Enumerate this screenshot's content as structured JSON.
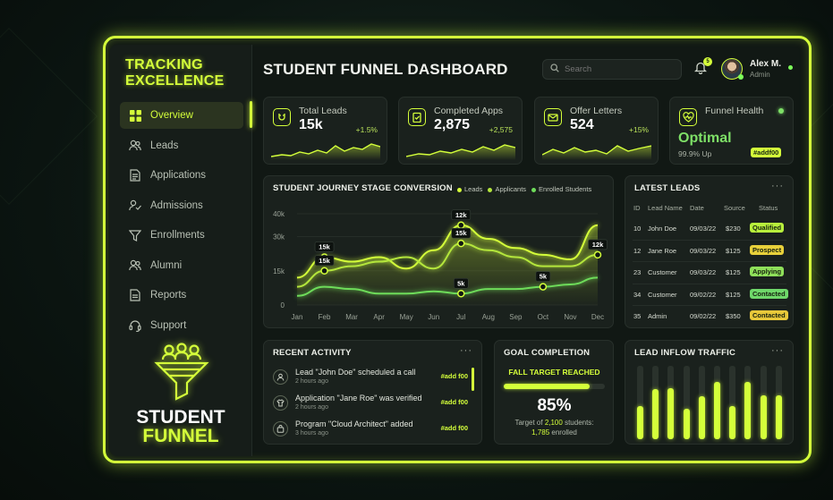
{
  "sidebar": {
    "brand_line1": "TRACKING",
    "brand_line2": "EXCELLENCE",
    "items": [
      {
        "label": "Overview",
        "icon": "grid-icon",
        "active": true
      },
      {
        "label": "Leads",
        "icon": "users-icon"
      },
      {
        "label": "Applications",
        "icon": "document-icon"
      },
      {
        "label": "Admissions",
        "icon": "user-check-icon"
      },
      {
        "label": "Enrollments",
        "icon": "funnel-icon"
      },
      {
        "label": "Alumni",
        "icon": "users-icon"
      },
      {
        "label": "Reports",
        "icon": "report-icon"
      },
      {
        "label": "Support",
        "icon": "headset-icon"
      }
    ],
    "logo_line1": "STUDENT",
    "logo_line2": "FUNNEL"
  },
  "header": {
    "title": "STUDENT FUNNEL DASHBOARD",
    "search_placeholder": "Search",
    "notification_count": "5",
    "user_name": "Alex M.",
    "user_role": "Admin"
  },
  "stats": [
    {
      "label": "Total Leads",
      "value": "15k",
      "change": "+1.5%",
      "icon": "magnet-icon"
    },
    {
      "label": "Completed Apps",
      "value": "2,875",
      "change": "+2,575",
      "icon": "clipboard-check-icon"
    },
    {
      "label": "Offer Letters",
      "value": "524",
      "change": "+15%",
      "icon": "envelope-icon"
    }
  ],
  "health": {
    "label": "Funnel Health",
    "value": "Optimal",
    "uptime": "99.9% Up",
    "tag": "#addf00"
  },
  "conversion": {
    "title": "STUDENT JOURNEY STAGE CONVERSION",
    "legend": [
      "Leads",
      "Applicants",
      "Enrolled Students"
    ]
  },
  "chart_data": {
    "type": "line",
    "title": "STUDENT JOURNEY STAGE CONVERSION",
    "categories": [
      "Jan",
      "Feb",
      "Mar",
      "Apr",
      "May",
      "Jun",
      "Jul",
      "Aug",
      "Sep",
      "Oct",
      "Nov",
      "Dec"
    ],
    "yticks": [
      "40k",
      "30k",
      "15k",
      "0"
    ],
    "ylim": [
      0,
      40000
    ],
    "series": [
      {
        "name": "Leads",
        "values": [
          12000,
          21000,
          19000,
          21000,
          16000,
          24000,
          35000,
          29000,
          25000,
          22000,
          20000,
          35000
        ],
        "color": "#d4ff3a"
      },
      {
        "name": "Applicants",
        "values": [
          8000,
          15000,
          17000,
          19000,
          21000,
          16000,
          27000,
          24000,
          21000,
          17000,
          17000,
          22000
        ],
        "color": "#b4e63c"
      },
      {
        "name": "Enrolled Students",
        "values": [
          4000,
          8000,
          7000,
          5000,
          5000,
          6000,
          5000,
          7000,
          7000,
          8000,
          9000,
          12000
        ],
        "color": "#6edc5a"
      }
    ],
    "annotations": [
      {
        "month": "Feb",
        "value": 15000,
        "label": "15k"
      },
      {
        "month": "Feb",
        "value": 15000,
        "label": "15k"
      },
      {
        "month": "Jul",
        "value": 12000,
        "label": "12k"
      },
      {
        "month": "Jul",
        "value": 15000,
        "label": "15k"
      },
      {
        "month": "Jul",
        "value": 5000,
        "label": "5k"
      },
      {
        "month": "Oct",
        "value": 5000,
        "label": "5k"
      },
      {
        "month": "Dec",
        "value": 12000,
        "label": "12k"
      }
    ]
  },
  "latest_leads": {
    "title": "LATEST LEADS",
    "headers": [
      "ID",
      "Lead Name",
      "Date",
      "Source",
      "Status"
    ],
    "rows": [
      {
        "id": "10",
        "name": "John Doe",
        "date": "09/03/22",
        "source": "$230",
        "status": "Qualified",
        "color": "#b8f03c"
      },
      {
        "id": "12",
        "name": "Jane Roe",
        "date": "09/03/22",
        "source": "$125",
        "status": "Prospect",
        "color": "#e8d03a"
      },
      {
        "id": "23",
        "name": "Customer",
        "date": "09/03/22",
        "source": "$125",
        "status": "Applying",
        "color": "#8fe05a"
      },
      {
        "id": "34",
        "name": "Customer",
        "date": "09/02/22",
        "source": "$125",
        "status": "Contacted",
        "color": "#6fd86a"
      },
      {
        "id": "35",
        "name": "Admin",
        "date": "09/02/22",
        "source": "$350",
        "status": "Contacted",
        "color": "#e8c83a"
      }
    ]
  },
  "activity": {
    "title": "RECENT ACTIVITY",
    "items": [
      {
        "text": "Lead \"John Doe\" scheduled a call",
        "time": "2 hours ago",
        "tag": "#add f00",
        "icon": "user-icon"
      },
      {
        "text": "Application \"Jane Roe\" was verified",
        "time": "2 hours ago",
        "tag": "#add f00",
        "icon": "shirt-icon"
      },
      {
        "text": "Program \"Cloud Architect\" added",
        "time": "3 hours ago",
        "tag": "#add f00",
        "icon": "bag-icon"
      }
    ]
  },
  "goal": {
    "title": "GOAL COMPLETION",
    "subtitle": "FALL TARGET REACHED",
    "progress": 0.85,
    "percent": "85%",
    "note_pre": "Target of ",
    "target": "2,100",
    "note_mid": " students:",
    "enrolled": "1,785",
    "note_post": " enrolled"
  },
  "traffic": {
    "title": "LEAD INFLOW TRAFFIC",
    "levels": [
      0.45,
      0.68,
      0.7,
      0.42,
      0.58,
      0.78,
      0.45,
      0.78,
      0.6,
      0.6
    ]
  }
}
